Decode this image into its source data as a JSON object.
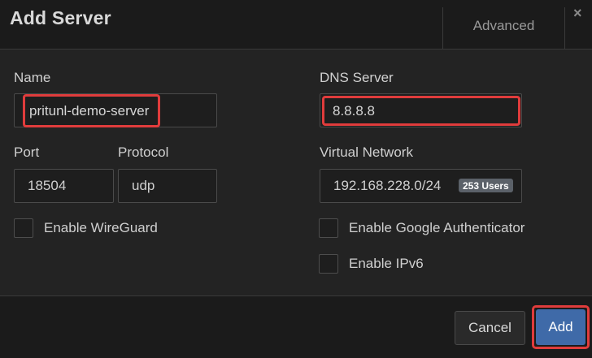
{
  "dialog": {
    "title": "Add Server",
    "advanced_tab": "Advanced",
    "close_symbol": "×"
  },
  "form": {
    "name_label": "Name",
    "name_value": "pritunl-demo-server",
    "dns_label": "DNS Server",
    "dns_value": "8.8.8.8",
    "port_label": "Port",
    "port_value": "18504",
    "protocol_label": "Protocol",
    "protocol_value": "udp",
    "vnet_label": "Virtual Network",
    "vnet_value": "192.168.228.0/24",
    "vnet_badge": "253 Users",
    "wireguard_label": "Enable WireGuard",
    "google_auth_label": "Enable Google Authenticator",
    "ipv6_label": "Enable IPv6"
  },
  "footer": {
    "cancel_label": "Cancel",
    "add_label": "Add"
  },
  "colors": {
    "highlight": "#e03c3c",
    "primary_button": "#3f6aa8"
  }
}
